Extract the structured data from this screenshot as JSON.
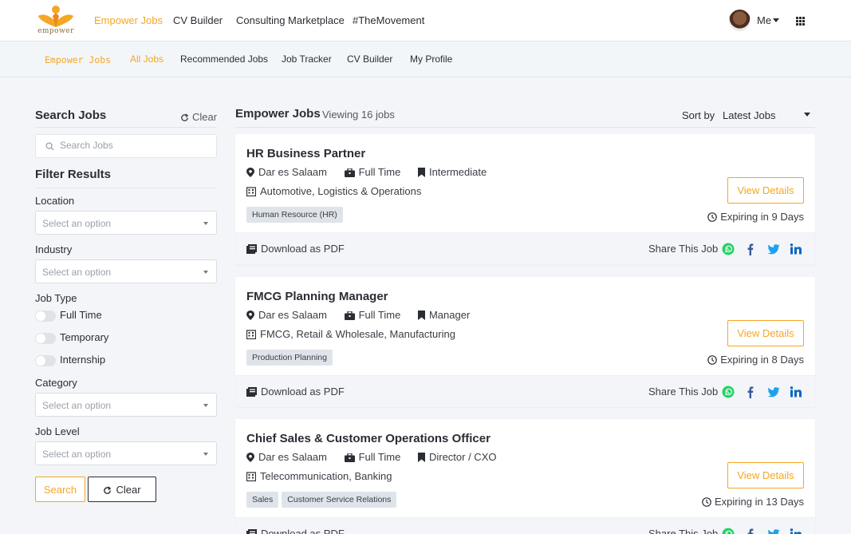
{
  "topnav": {
    "logo_text": "empower",
    "items": [
      "Empower Jobs",
      "CV Builder",
      "Consulting Marketplace",
      "#TheMovement"
    ],
    "user_label": "Me"
  },
  "subnav": {
    "brand": "Empower Jobs",
    "items": [
      "All Jobs",
      "Recommended Jobs",
      "Job Tracker",
      "CV Builder",
      "My Profile"
    ]
  },
  "sidebar": {
    "title": "Search Jobs",
    "clear_label": "Clear",
    "search_placeholder": "Search Jobs",
    "filter_title": "Filter Results",
    "location_label": "Location",
    "industry_label": "Industry",
    "job_type_label": "Job Type",
    "job_types": [
      "Full Time",
      "Temporary",
      "Internship"
    ],
    "category_label": "Category",
    "job_level_label": "Job Level",
    "select_placeholder": "Select an option",
    "search_button": "Search",
    "clear_button": "Clear"
  },
  "main": {
    "title": "Empower Jobs",
    "viewing": "Viewing 16 jobs",
    "sort_label": "Sort by",
    "sort_value": "Latest Jobs",
    "download_label": "Download as PDF",
    "share_label": "Share This Job",
    "view_label": "View Details",
    "jobs": [
      {
        "title": "HR Business Partner",
        "location": "Dar es Salaam",
        "type": "Full Time",
        "level": "Intermediate",
        "industry": "Automotive, Logistics & Operations",
        "tags": [
          "Human Resource (HR)"
        ],
        "expiring": "Expiring in 9 Days"
      },
      {
        "title": "FMCG Planning Manager",
        "location": "Dar es Salaam",
        "type": "Full Time",
        "level": "Manager",
        "industry": "FMCG, Retail & Wholesale, Manufacturing",
        "tags": [
          "Production Planning"
        ],
        "expiring": "Expiring in 8 Days"
      },
      {
        "title": "Chief Sales & Customer Operations Officer",
        "location": "Dar es Salaam",
        "type": "Full Time",
        "level": "Director / CXO",
        "industry": "Telecommunication, Banking",
        "tags": [
          "Sales",
          "Customer Service Relations"
        ],
        "expiring": "Expiring in 13 Days"
      }
    ]
  },
  "colors": {
    "accent": "#f5a623",
    "whatsapp": "#25d366",
    "facebook": "#3b5998",
    "twitter": "#1da1f2",
    "linkedin": "#0a66c2"
  }
}
